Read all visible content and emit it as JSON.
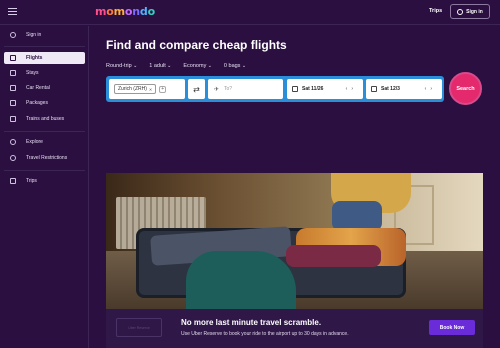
{
  "header": {
    "logo_parts": [
      "m",
      "o",
      "m",
      "o",
      "n",
      "d",
      "o"
    ],
    "trips_label": "Trips",
    "signin_label": "Sign in"
  },
  "sidebar": {
    "items": [
      {
        "label": "Sign in",
        "icon": "user-icon"
      },
      {
        "label": "Flights",
        "icon": "plane-icon",
        "active": true
      },
      {
        "label": "Stays",
        "icon": "bed-icon"
      },
      {
        "label": "Car Rental",
        "icon": "car-icon"
      },
      {
        "label": "Packages",
        "icon": "package-icon"
      },
      {
        "label": "Trains and buses",
        "icon": "train-icon"
      },
      {
        "label": "Explore",
        "icon": "globe-icon"
      },
      {
        "label": "Travel Restrictions",
        "icon": "info-icon"
      },
      {
        "label": "Trips",
        "icon": "suitcase-icon"
      }
    ]
  },
  "main": {
    "title": "Find and compare cheap flights",
    "options": {
      "trip_type": "Round-trip",
      "travelers": "1 adult",
      "cabin": "Economy",
      "bags": "0 bags"
    },
    "search": {
      "from_chip": "Zurich (ZRH)",
      "to_placeholder": "To?",
      "depart_date": "Sat 11/26",
      "return_date": "Sat 12/3",
      "search_label": "Search"
    }
  },
  "promo": {
    "logo_text": "Uber Reserve",
    "title": "No more last minute travel scramble.",
    "subtitle": "Use Uber Reserve to book your ride to the airport up to 30 days in advance.",
    "cta_label": "Book Now"
  },
  "colors": {
    "background": "#2a0f40",
    "search_bar": "#2b8ed8",
    "search_button": "#e42a6c",
    "cta": "#6a2bd9"
  }
}
